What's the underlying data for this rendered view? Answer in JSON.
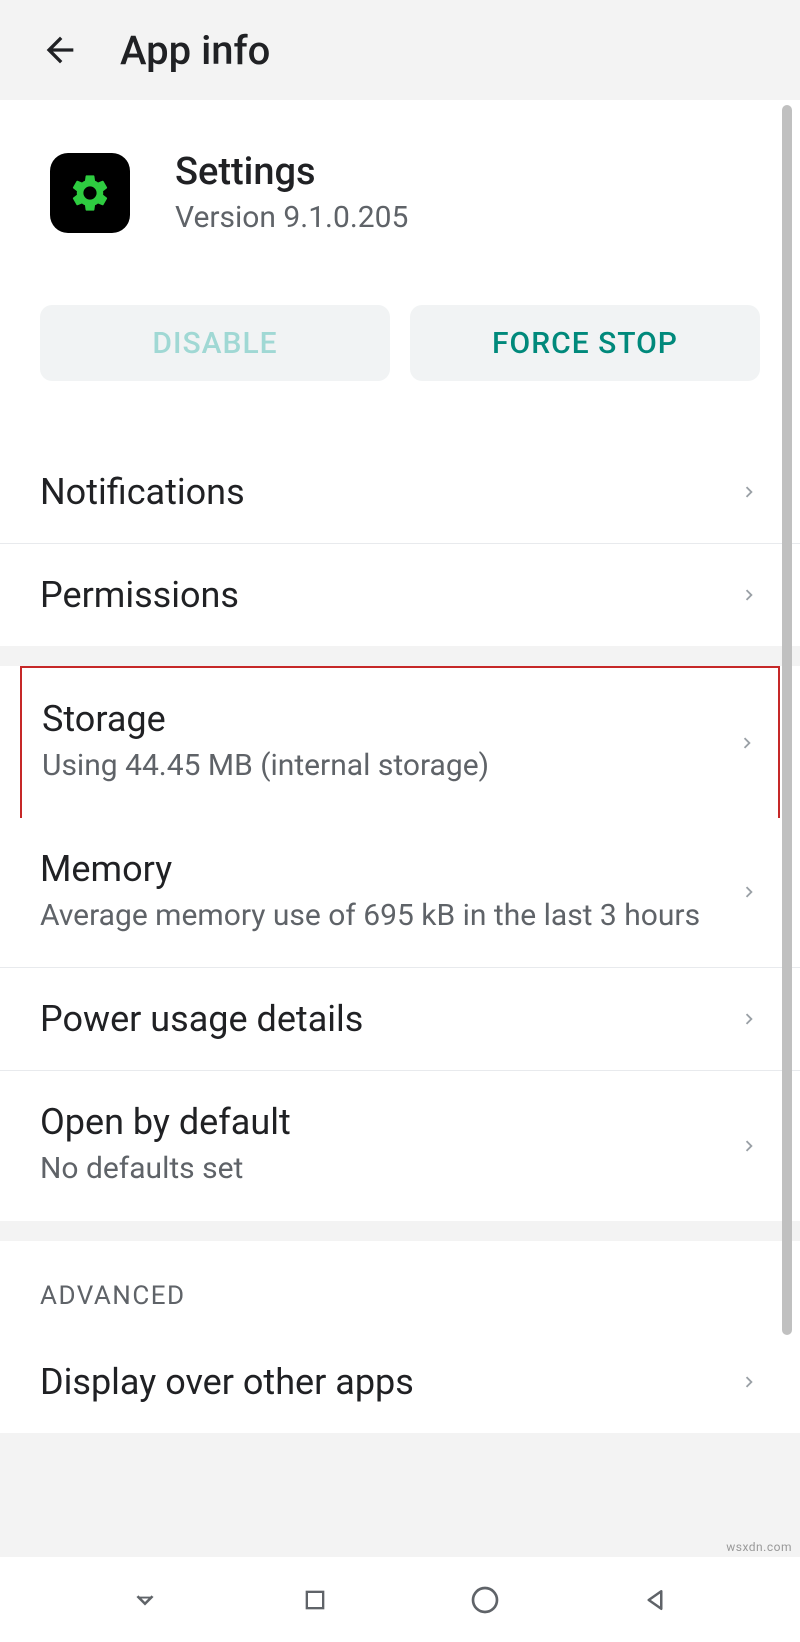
{
  "header": {
    "title": "App info"
  },
  "app": {
    "name": "Settings",
    "version": "Version 9.1.0.205"
  },
  "buttons": {
    "disable": "DISABLE",
    "force_stop": "FORCE STOP"
  },
  "items": {
    "notifications": {
      "title": "Notifications"
    },
    "permissions": {
      "title": "Permissions"
    },
    "storage": {
      "title": "Storage",
      "subtitle": "Using 44.45 MB (internal storage)"
    },
    "memory": {
      "title": "Memory",
      "subtitle": "Average memory use of 695 kB in the last 3 hours"
    },
    "power": {
      "title": "Power usage details"
    },
    "open_default": {
      "title": "Open by default",
      "subtitle": "No defaults set"
    },
    "display_over": {
      "title": "Display over other apps"
    }
  },
  "section": {
    "advanced": "ADVANCED"
  },
  "watermark": "wsxdn.com"
}
